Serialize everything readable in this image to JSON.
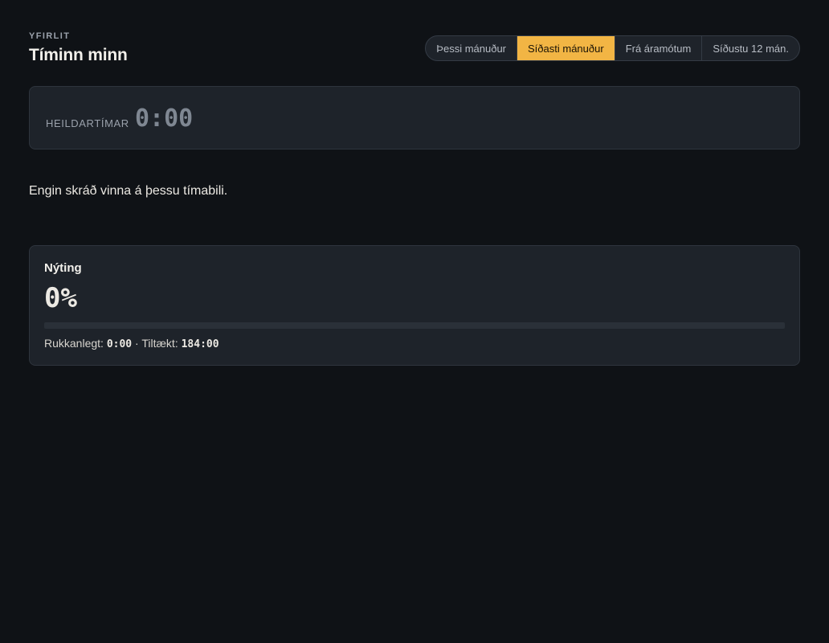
{
  "header": {
    "eyebrow": "YFIRLIT",
    "title": "Tíminn minn"
  },
  "periods": [
    {
      "label": "Þessi mánuður",
      "active": false
    },
    {
      "label": "Síðasti mánuður",
      "active": true
    },
    {
      "label": "Frá áramótum",
      "active": false
    },
    {
      "label": "Síðustu 12 mán.",
      "active": false
    }
  ],
  "total": {
    "label": "Heildartímar",
    "value": "0:00"
  },
  "empty_message": "Engin skráð vinna á þessu tímabili.",
  "utilization": {
    "title": "Nýting",
    "percent_text": "0%",
    "percent_value": 0,
    "billable_label": "Rukkanlegt:",
    "billable_value": "0:00",
    "separator": "·",
    "available_label": "Tiltækt:",
    "available_value": "184:00"
  },
  "colors": {
    "accent": "#f2b544",
    "background": "#0f1216",
    "card": "#1e232a"
  }
}
